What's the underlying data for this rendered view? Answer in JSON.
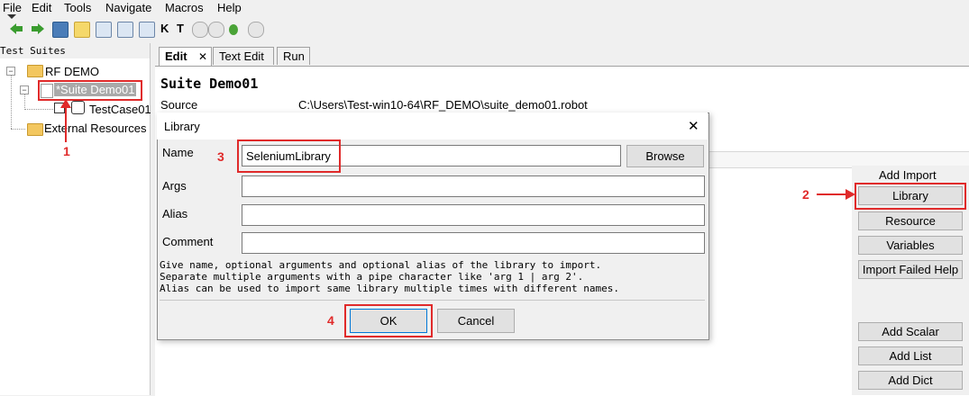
{
  "menu": [
    "File",
    "Edit",
    "Tools",
    "Navigate",
    "Macros",
    "Help"
  ],
  "tree": {
    "header": "Test Suites",
    "rf_demo": "RF DEMO",
    "suite": "*Suite Demo01",
    "testcase": "TestCase01",
    "external": "External Resources"
  },
  "tabs": [
    "Edit",
    "Text Edit",
    "Run"
  ],
  "suite_title": "Suite Demo01",
  "source_label": "Source",
  "source_value": "C:\\Users\\Test-win10-64\\RF_DEMO\\suite_demo01.robot",
  "right_panel": {
    "add_import": "Add Import",
    "library": "Library",
    "resource": "Resource",
    "variables": "Variables",
    "import_failed": "Import Failed Help",
    "add_scalar": "Add Scalar",
    "add_list": "Add List",
    "add_dict": "Add Dict"
  },
  "dialog": {
    "title": "Library",
    "close": "✕",
    "name_label": "Name",
    "name_value": "SeleniumLibrary",
    "args_label": "Args",
    "alias_label": "Alias",
    "comment_label": "Comment",
    "browse": "Browse",
    "help_line1": "Give name, optional arguments and optional alias of the library to import.",
    "help_line2": "Separate multiple arguments with a pipe character like 'arg 1 | arg 2'.",
    "help_line3": "Alias can be used to import same library multiple times with different names.",
    "ok": "OK",
    "cancel": "Cancel"
  },
  "annotations": {
    "n1": "1",
    "n2": "2",
    "n3": "3",
    "n4": "4"
  },
  "colors": {
    "annotation_red": "#e02a2a",
    "selection_gray": "#a9a9a9"
  }
}
